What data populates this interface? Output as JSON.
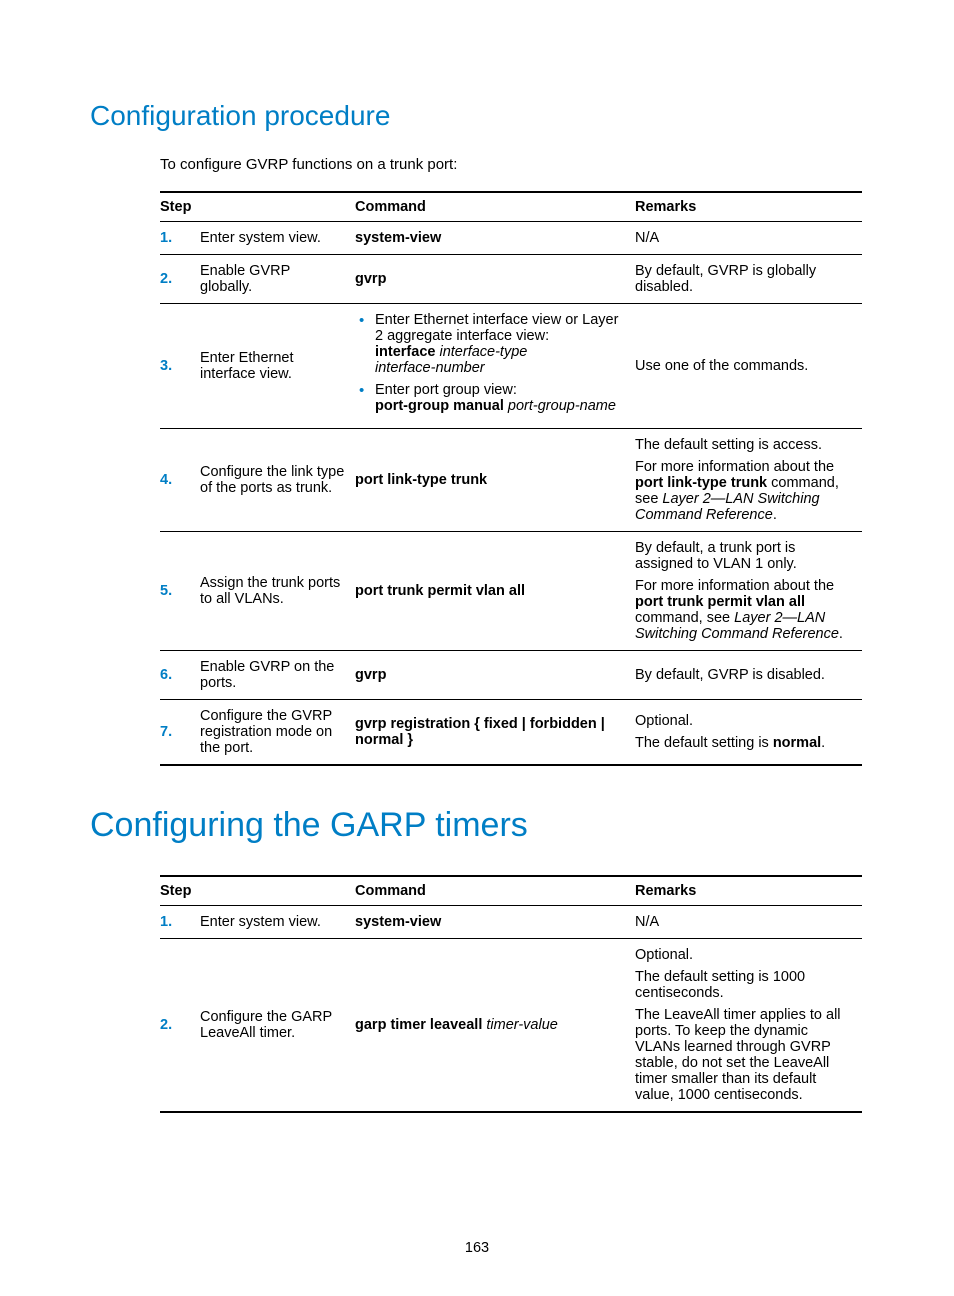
{
  "heading_sub": "Configuration procedure",
  "intro": "To configure GVRP functions on a trunk port:",
  "th_step": "Step",
  "th_cmd": "Command",
  "th_rem": "Remarks",
  "t1": {
    "r1": {
      "n": "1.",
      "step": "Enter system view.",
      "cmd": "system-view",
      "rem": "N/A"
    },
    "r2": {
      "n": "2.",
      "step": "Enable GVRP globally.",
      "cmd": "gvrp",
      "rem": "By default, GVRP is globally disabled."
    },
    "r3": {
      "n": "3.",
      "step": "Enter Ethernet interface view.",
      "b1a": "Enter Ethernet interface view or Layer 2 aggregate interface view:",
      "b1b_pre": "interface ",
      "b1b_it1": "interface-type",
      "b1b_it2": "interface-number",
      "b2a": "Enter port group view:",
      "b2b_pre": "port-group manual ",
      "b2b_it": "port-group-name",
      "rem": "Use one of the commands."
    },
    "r4": {
      "n": "4.",
      "step": "Configure the link type of the ports as trunk.",
      "cmd": "port link-type trunk",
      "rem_p1": "The default setting is access.",
      "rem_p2_a": "For more information about the ",
      "rem_p2_b": "port link-type trunk",
      "rem_p2_c": " command, see ",
      "rem_p2_d": "Layer 2—LAN Switching Command Reference",
      "rem_p2_e": "."
    },
    "r5": {
      "n": "5.",
      "step": "Assign the trunk ports to all VLANs.",
      "cmd": "port trunk permit vlan all",
      "rem_p1": "By default, a trunk port is assigned to VLAN 1 only.",
      "rem_p2_a": "For more information about the ",
      "rem_p2_b": "port trunk permit vlan all",
      "rem_p2_c": " command, see ",
      "rem_p2_d": "Layer 2—LAN Switching Command Reference",
      "rem_p2_e": "."
    },
    "r6": {
      "n": "6.",
      "step": "Enable GVRP on the ports.",
      "cmd": "gvrp",
      "rem": "By default, GVRP is disabled."
    },
    "r7": {
      "n": "7.",
      "step": "Configure the GVRP registration mode on the port.",
      "cmd": "gvrp registration { fixed | forbidden | normal }",
      "rem_p1": "Optional.",
      "rem_p2_a": "The default setting is ",
      "rem_p2_b": "normal",
      "rem_p2_c": "."
    }
  },
  "heading_main": "Configuring the GARP timers",
  "t2": {
    "r1": {
      "n": "1.",
      "step": "Enter system view.",
      "cmd": "system-view",
      "rem": "N/A"
    },
    "r2": {
      "n": "2.",
      "step": "Configure the GARP LeaveAll timer.",
      "cmd_b": "garp timer leaveall ",
      "cmd_i": "timer-value",
      "rem_p1": "Optional.",
      "rem_p2": "The default setting is 1000 centiseconds.",
      "rem_p3": "The LeaveAll timer applies to all ports. To keep the dynamic VLANs learned through GVRP stable, do not set the LeaveAll timer smaller than its default value, 1000 centiseconds."
    }
  },
  "pagenum": "163"
}
